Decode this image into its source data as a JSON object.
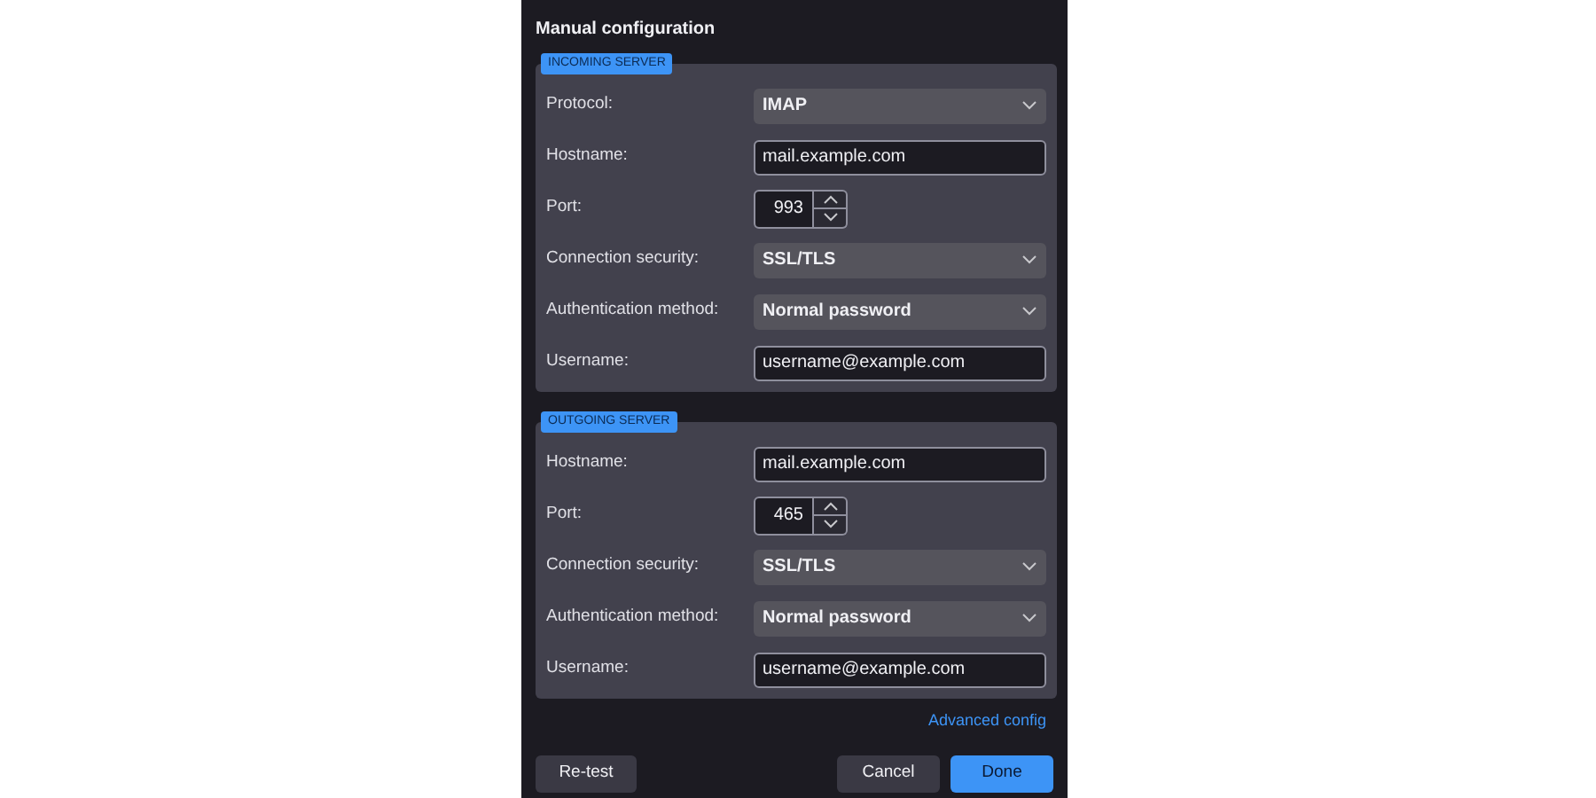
{
  "dialog": {
    "title": "Manual configuration"
  },
  "sections": [
    {
      "badge": "INCOMING SERVER",
      "rows": [
        {
          "kind": "select",
          "label": "Protocol:",
          "value": "IMAP"
        },
        {
          "kind": "text",
          "label": "Hostname:",
          "value": "mail.example.com"
        },
        {
          "kind": "port",
          "label": "Port:",
          "value": "993"
        },
        {
          "kind": "select",
          "label": "Connection security:",
          "value": "SSL/TLS"
        },
        {
          "kind": "select",
          "label": "Authentication method:",
          "value": "Normal password"
        },
        {
          "kind": "text",
          "label": "Username:",
          "value": "username@example.com"
        }
      ]
    },
    {
      "badge": "OUTGOING SERVER",
      "rows": [
        {
          "kind": "text",
          "label": "Hostname:",
          "value": "mail.example.com"
        },
        {
          "kind": "port",
          "label": "Port:",
          "value": "465"
        },
        {
          "kind": "select",
          "label": "Connection security:",
          "value": "SSL/TLS"
        },
        {
          "kind": "select",
          "label": "Authentication method:",
          "value": "Normal password"
        },
        {
          "kind": "text",
          "label": "Username:",
          "value": "username@example.com"
        }
      ]
    }
  ],
  "advanced_link": "Advanced config",
  "buttons": {
    "retest": "Re-test",
    "cancel": "Cancel",
    "done": "Done"
  }
}
